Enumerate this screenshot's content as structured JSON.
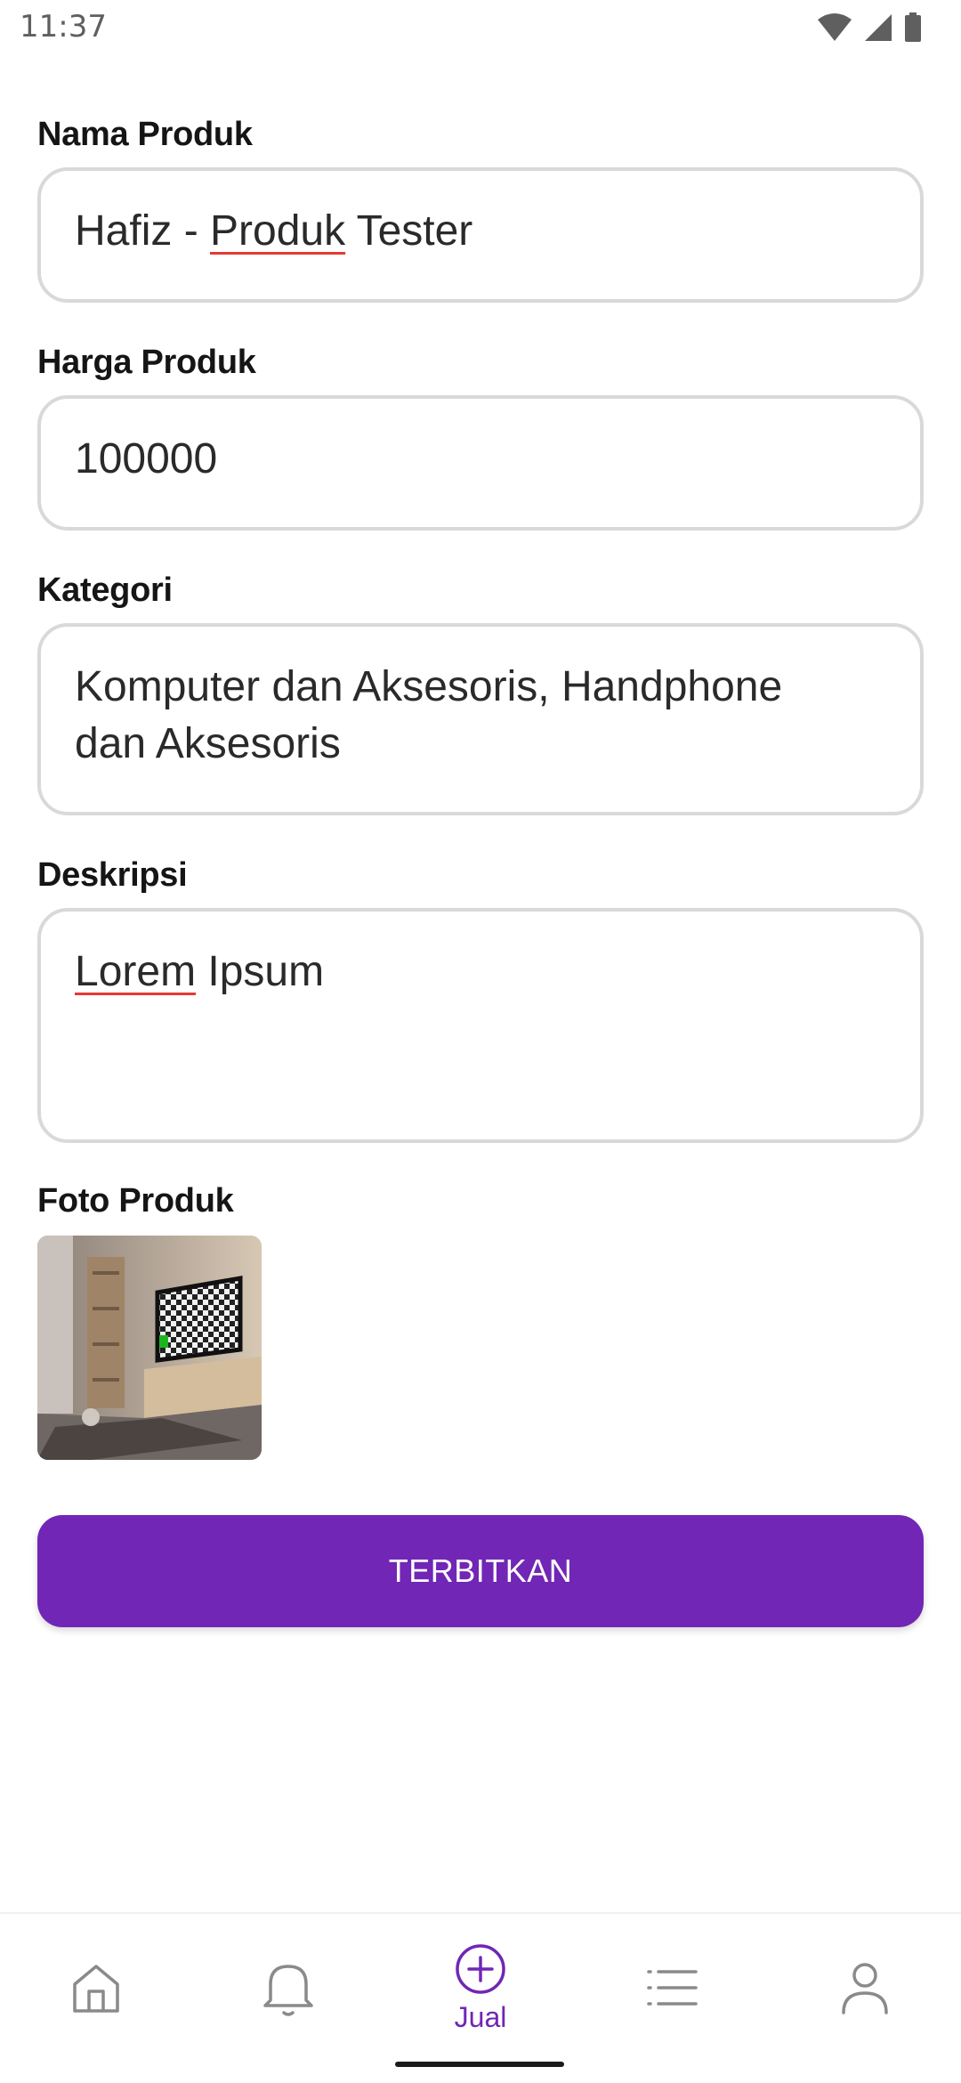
{
  "status_bar": {
    "time": "11:37",
    "icons": [
      "wifi-icon",
      "signal-icon",
      "battery-icon"
    ]
  },
  "form": {
    "name": {
      "label": "Nama Produk",
      "value_prefix": "Hafiz - ",
      "value_underlined": "Produk",
      "value_suffix": " Tester"
    },
    "price": {
      "label": "Harga Produk",
      "value": "100000"
    },
    "category": {
      "label": "Kategori",
      "value_line1": "Komputer dan Aksesoris, Handphone",
      "value_line2": "dan Aksesoris"
    },
    "description": {
      "label": "Deskripsi",
      "value_underlined": "Lorem",
      "value_suffix": " Ipsum"
    },
    "photo": {
      "label": "Foto Produk"
    },
    "submit_label": "TERBITKAN"
  },
  "bottom_nav": {
    "items": [
      {
        "icon": "home-icon",
        "label": ""
      },
      {
        "icon": "bell-icon",
        "label": ""
      },
      {
        "icon": "plus-circle-icon",
        "label": "Jual",
        "active": true
      },
      {
        "icon": "list-icon",
        "label": ""
      },
      {
        "icon": "user-icon",
        "label": ""
      }
    ]
  },
  "colors": {
    "accent": "#7126b5",
    "field_border": "#d9d9d9",
    "nav_icon": "#8a8a8a"
  }
}
